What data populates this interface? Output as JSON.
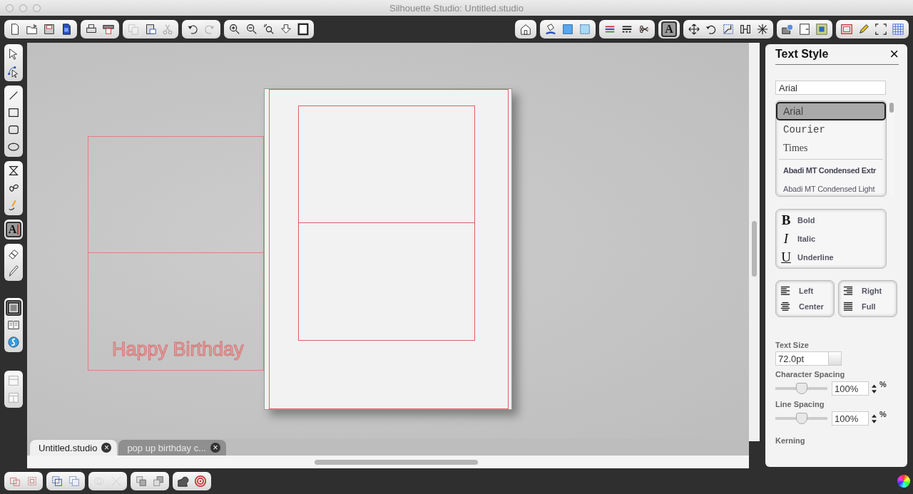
{
  "window": {
    "title": "Silhouette Studio: Untitled.studio"
  },
  "top_toolbar_left": [
    [
      {
        "disabled": false,
        "selected": false
      },
      {
        "disabled": false,
        "selected": false
      },
      {
        "disabled": false,
        "selected": false
      },
      {
        "disabled": false,
        "selected": false
      }
    ],
    [
      {
        "disabled": false,
        "selected": false
      },
      {
        "disabled": false,
        "selected": false
      }
    ],
    [
      {
        "disabled": true,
        "selected": false
      },
      {
        "disabled": false,
        "selected": false
      },
      {
        "disabled": true,
        "selected": false
      }
    ],
    [
      {
        "disabled": false,
        "selected": false
      },
      {
        "disabled": true,
        "selected": false
      }
    ],
    [
      {
        "disabled": false,
        "selected": false
      },
      {
        "disabled": false,
        "selected": false
      },
      {
        "disabled": false,
        "selected": false
      },
      {
        "disabled": false,
        "selected": false
      },
      {
        "disabled": false,
        "selected": false
      }
    ]
  ],
  "top_toolbar_right": [
    [
      {
        "disabled": false,
        "selected": false
      }
    ],
    [
      {
        "disabled": false,
        "selected": false
      },
      {
        "disabled": false,
        "selected": false
      },
      {
        "disabled": false,
        "selected": false
      }
    ],
    [
      {
        "disabled": false,
        "selected": false
      },
      {
        "disabled": false,
        "selected": false
      },
      {
        "disabled": false,
        "selected": false
      }
    ],
    [
      {
        "disabled": false,
        "selected": true,
        "label": "A"
      }
    ],
    [
      {
        "disabled": false,
        "selected": false
      },
      {
        "disabled": false,
        "selected": false
      },
      {
        "disabled": false,
        "selected": false
      },
      {
        "disabled": false,
        "selected": false
      },
      {
        "disabled": false,
        "selected": false
      }
    ],
    [
      {
        "disabled": false,
        "selected": false
      },
      {
        "disabled": false,
        "selected": false
      },
      {
        "disabled": false,
        "selected": false
      }
    ],
    [
      {
        "disabled": false,
        "selected": false
      },
      {
        "disabled": false,
        "selected": false
      },
      {
        "disabled": false,
        "selected": false
      },
      {
        "disabled": false,
        "selected": false
      }
    ]
  ],
  "left_toolbar": [
    [
      {
        "selected": false
      },
      {
        "selected": false
      }
    ],
    [
      {
        "selected": false
      },
      {
        "selected": false
      },
      {
        "selected": false
      },
      {
        "selected": false
      }
    ],
    [
      {
        "selected": false
      },
      {
        "selected": false
      },
      {
        "selected": false
      }
    ],
    [
      {
        "selected": true,
        "label": "A"
      }
    ],
    [
      {
        "selected": false
      },
      {
        "selected": false
      }
    ],
    [
      {
        "selected": true
      },
      {
        "selected": false
      },
      {
        "selected": false
      }
    ],
    [
      {
        "selected": false
      },
      {
        "selected": false
      }
    ]
  ],
  "canvas": {
    "text": "Happy Birthday"
  },
  "document_tabs": [
    {
      "label": "Untitled.studio",
      "selected": true,
      "close": "×"
    },
    {
      "label": "pop up birthday c...",
      "selected": false,
      "close": "×"
    }
  ],
  "bottom_toolbar": [
    [
      {
        "disabled": false
      },
      {
        "disabled": false
      }
    ],
    [
      {
        "disabled": false
      },
      {
        "disabled": false
      }
    ],
    [
      {
        "disabled": true
      },
      {
        "disabled": true
      }
    ],
    [
      {
        "disabled": false
      },
      {
        "disabled": false
      }
    ],
    [
      {
        "disabled": false
      },
      {
        "disabled": false
      }
    ]
  ],
  "text_style_panel": {
    "title": "Text Style",
    "close": "×",
    "font_field": {
      "value": "Arial"
    },
    "font_list": {
      "recent": [
        {
          "name": "Arial",
          "kind": "sans",
          "selected": true
        },
        {
          "name": "Courier",
          "kind": "mono",
          "selected": false
        },
        {
          "name": "Times",
          "kind": "serif",
          "selected": false
        }
      ],
      "all": [
        {
          "name": "Abadi MT Condensed Extr",
          "kind": "condensed-bold",
          "selected": false
        },
        {
          "name": "Abadi MT Condensed Light",
          "kind": "condensed-light",
          "selected": false
        }
      ]
    },
    "styles": [
      {
        "glyph": "B",
        "label": "Bold",
        "kind": "bold",
        "selected": false
      },
      {
        "glyph": "I",
        "label": "Italic",
        "kind": "italic",
        "selected": false
      },
      {
        "glyph": "U",
        "label": "Underline",
        "kind": "underline",
        "selected": false
      }
    ],
    "alignment": [
      [
        {
          "label": "Left",
          "kind": "left"
        },
        {
          "label": "Center",
          "kind": "center"
        }
      ],
      [
        {
          "label": "Right",
          "kind": "right"
        },
        {
          "label": "Full",
          "kind": "full"
        }
      ]
    ],
    "text_size": {
      "label": "Text Size",
      "value": "72.0pt"
    },
    "character_spacing": {
      "label": "Character Spacing",
      "level": 0.5,
      "value": "100%",
      "unit": "%"
    },
    "line_spacing": {
      "label": "Line Spacing",
      "level": 0.5,
      "value": "100%",
      "unit": "%"
    },
    "kerning": {
      "label": "Kerning"
    }
  }
}
